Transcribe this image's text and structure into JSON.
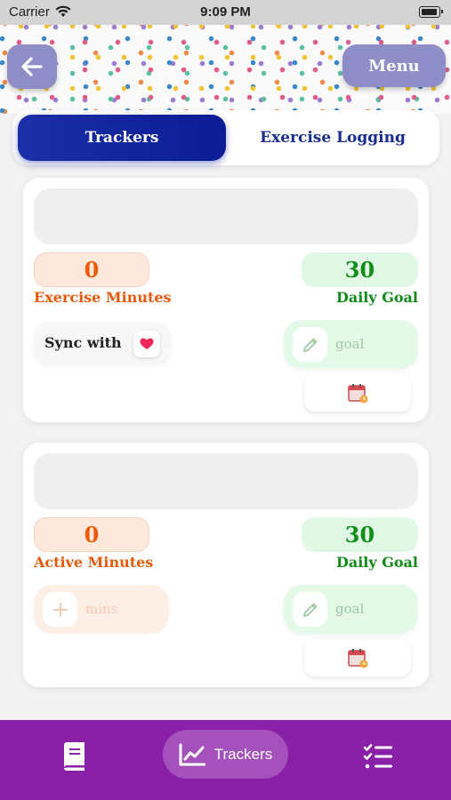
{
  "status_bar": {
    "carrier": "Carrier",
    "time": "9:09 PM"
  },
  "header": {
    "menu_label": "Menu"
  },
  "tabs": [
    {
      "label": "Trackers",
      "active": true
    },
    {
      "label": "Exercise Logging",
      "active": false
    }
  ],
  "cards": [
    {
      "value": "0",
      "value_label": "Exercise Minutes",
      "goal_value": "30",
      "goal_label": "Daily Goal",
      "sync_label": "Sync with",
      "goal_placeholder": "goal"
    },
    {
      "value": "0",
      "value_label": "Active Minutes",
      "goal_value": "30",
      "goal_label": "Daily Goal",
      "mins_placeholder": "mins",
      "goal_placeholder": "goal"
    }
  ],
  "bottom_nav": {
    "items": [
      {
        "icon": "book-icon",
        "label": ""
      },
      {
        "icon": "chart-line-icon",
        "label": "Trackers"
      },
      {
        "icon": "checklist-icon",
        "label": ""
      }
    ]
  },
  "colors": {
    "primary_blue": "#0b1c94",
    "accent_purple": "#8b20a8",
    "header_button": "#8e8dc8",
    "orange": "#ee5b08",
    "green": "#109018"
  }
}
